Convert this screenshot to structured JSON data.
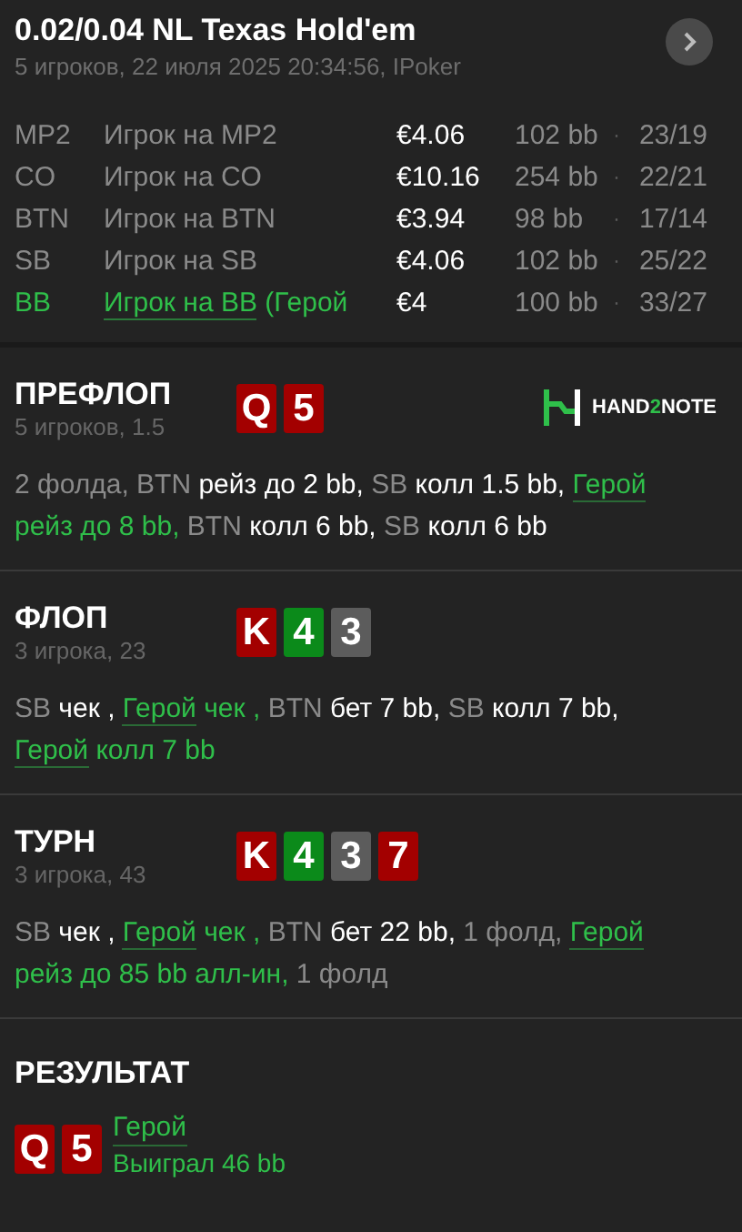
{
  "header": {
    "title": "0.02/0.04 NL Texas Hold'em",
    "subtitle": "5 игроков, 22 июля 2025 20:34:56, IPoker"
  },
  "players": [
    {
      "position": "MP2",
      "name": "Игрок на MP2",
      "stack": "€4.06",
      "bb": "102 bb",
      "separator": "·",
      "stats": "23/19",
      "hero": false
    },
    {
      "position": "CO",
      "name": "Игрок на CO",
      "stack": "€10.16",
      "bb": "254 bb",
      "separator": "·",
      "stats": "22/21",
      "hero": false
    },
    {
      "position": "BTN",
      "name": "Игрок на BTN",
      "stack": "€3.94",
      "bb": "98 bb",
      "separator": "·",
      "stats": "17/14",
      "hero": false
    },
    {
      "position": "SB",
      "name": "Игрок на SB",
      "stack": "€4.06",
      "bb": "102 bb",
      "separator": "·",
      "stats": "25/22",
      "hero": false
    },
    {
      "position": "BB",
      "name": "Игрок на BB",
      "note": "(Герой",
      "stack": "€4",
      "bb": "100 bb",
      "separator": "·",
      "stats": "33/27",
      "hero": true
    }
  ],
  "streets": [
    {
      "title": "ПРЕФЛОП",
      "info": "5 игроков, 1.5",
      "logo": {
        "before": "HAND",
        "highlight": "2",
        "after": "NOTE"
      },
      "cards": [
        {
          "rank": "Q",
          "color": "#a30000"
        },
        {
          "rank": "5",
          "color": "#a30000"
        }
      ],
      "actions": [
        {
          "kind": "muted",
          "text": "2 фолда, "
        },
        {
          "kind": "actor",
          "text": "BTN"
        },
        {
          "kind": "action",
          "text": " рейз до 2 bb, "
        },
        {
          "kind": "actor",
          "text": "SB"
        },
        {
          "kind": "action",
          "text": " колл 1.5 bb, "
        },
        {
          "kind": "hero",
          "text": "Герой"
        },
        {
          "kind": "hero_action",
          "text": " рейз до 8 bb, "
        },
        {
          "kind": "actor",
          "text": "BTN"
        },
        {
          "kind": "action",
          "text": " колл 6 bb, "
        },
        {
          "kind": "actor",
          "text": "SB"
        },
        {
          "kind": "action",
          "text": " колл 6 bb"
        }
      ]
    },
    {
      "title": "ФЛОП",
      "info": "3 игрока, 23",
      "cards": [
        {
          "rank": "K",
          "color": "#a30000"
        },
        {
          "rank": "4",
          "color": "#0b8a1a"
        },
        {
          "rank": "3",
          "color": "#5c5c5c"
        }
      ],
      "actions": [
        {
          "kind": "actor",
          "text": "SB"
        },
        {
          "kind": "action",
          "text": " чек , "
        },
        {
          "kind": "hero",
          "text": "Герой"
        },
        {
          "kind": "hero_action",
          "text": " чек , "
        },
        {
          "kind": "actor",
          "text": "BTN"
        },
        {
          "kind": "action",
          "text": " бет 7 bb, "
        },
        {
          "kind": "actor",
          "text": "SB"
        },
        {
          "kind": "action",
          "text": " колл 7 bb, "
        },
        {
          "kind": "hero",
          "text": "Герой"
        },
        {
          "kind": "hero_action",
          "text": " колл 7 bb"
        }
      ]
    },
    {
      "title": "ТУРН",
      "info": "3 игрока, 43",
      "cards": [
        {
          "rank": "K",
          "color": "#a30000"
        },
        {
          "rank": "4",
          "color": "#0b8a1a"
        },
        {
          "rank": "3",
          "color": "#5c5c5c"
        },
        {
          "rank": "7",
          "color": "#a30000"
        }
      ],
      "actions": [
        {
          "kind": "actor",
          "text": "SB"
        },
        {
          "kind": "action",
          "text": " чек , "
        },
        {
          "kind": "hero",
          "text": "Герой"
        },
        {
          "kind": "hero_action",
          "text": " чек , "
        },
        {
          "kind": "actor",
          "text": "BTN"
        },
        {
          "kind": "action",
          "text": " бет 22 bb, "
        },
        {
          "kind": "muted",
          "text": "1 фолд, "
        },
        {
          "kind": "hero",
          "text": "Герой"
        },
        {
          "kind": "hero_action",
          "text": " рейз до 85 bb алл-ин, "
        },
        {
          "kind": "muted",
          "text": "1 фолд"
        }
      ]
    }
  ],
  "result": {
    "title": "РЕЗУЛЬТАТ",
    "cards": [
      {
        "rank": "Q",
        "color": "#a30000"
      },
      {
        "rank": "5",
        "color": "#a30000"
      }
    ],
    "player": "Герой",
    "outcome": "Выиграл 46 bb"
  }
}
